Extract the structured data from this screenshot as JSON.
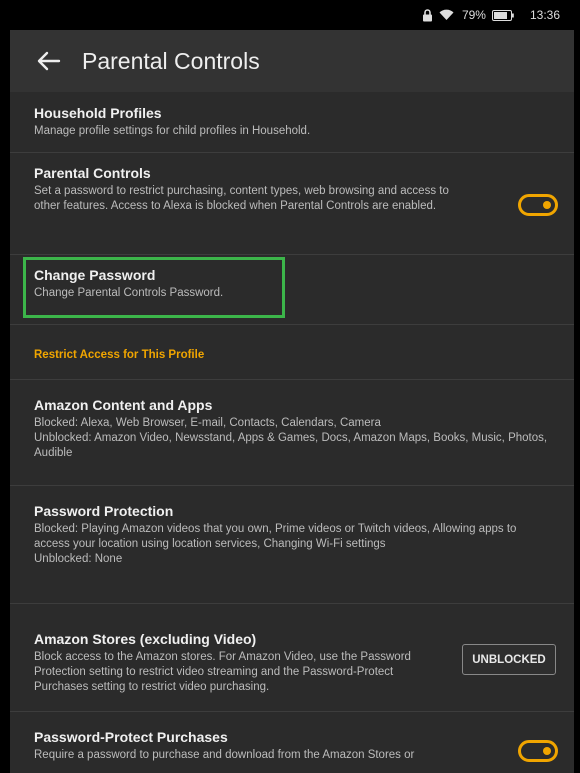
{
  "status_bar": {
    "battery_percent": "79%",
    "time": "13:36",
    "icons": [
      "lock-icon",
      "wifi-icon",
      "battery-icon"
    ]
  },
  "app_bar": {
    "title": "Parental Controls",
    "back_icon": "back-arrow-icon"
  },
  "items": {
    "household": {
      "title": "Household Profiles",
      "desc": "Manage profile settings for child profiles in Household."
    },
    "parental": {
      "title": "Parental Controls",
      "desc": "Set a password to restrict purchasing, content types, web browsing and access to other features. Access to Alexa is blocked when Parental Controls are enabled.",
      "toggle_on": true
    },
    "change_password": {
      "title": "Change Password",
      "desc": "Change Parental Controls Password."
    },
    "section_header": "Restrict Access for This Profile",
    "content_apps": {
      "title": "Amazon Content and Apps",
      "desc_blocked": "Blocked: Alexa, Web Browser, E-mail, Contacts, Calendars, Camera",
      "desc_unblocked": "Unblocked: Amazon Video, Newsstand, Apps & Games, Docs, Amazon Maps, Books, Music, Photos, Audible"
    },
    "password_protection": {
      "title": "Password Protection",
      "desc_blocked": "Blocked: Playing Amazon videos that you own, Prime videos or Twitch videos, Allowing apps to access your location using location services, Changing Wi-Fi settings",
      "desc_unblocked": "Unblocked: None"
    },
    "stores": {
      "title": "Amazon Stores (excluding Video)",
      "desc": "Block access to the Amazon stores. For Amazon Video, use the Password Protection setting to restrict video streaming and the Password-Protect Purchases setting to restrict video purchasing.",
      "button_label": "UNBLOCKED"
    },
    "purchases": {
      "title": "Password-Protect Purchases",
      "desc": "Require a password to purchase and download from the Amazon Stores or",
      "toggle_on": true
    }
  },
  "colors": {
    "accent": "#f0a500",
    "highlight": "#3cb54a",
    "background": "#2b2b2b"
  }
}
